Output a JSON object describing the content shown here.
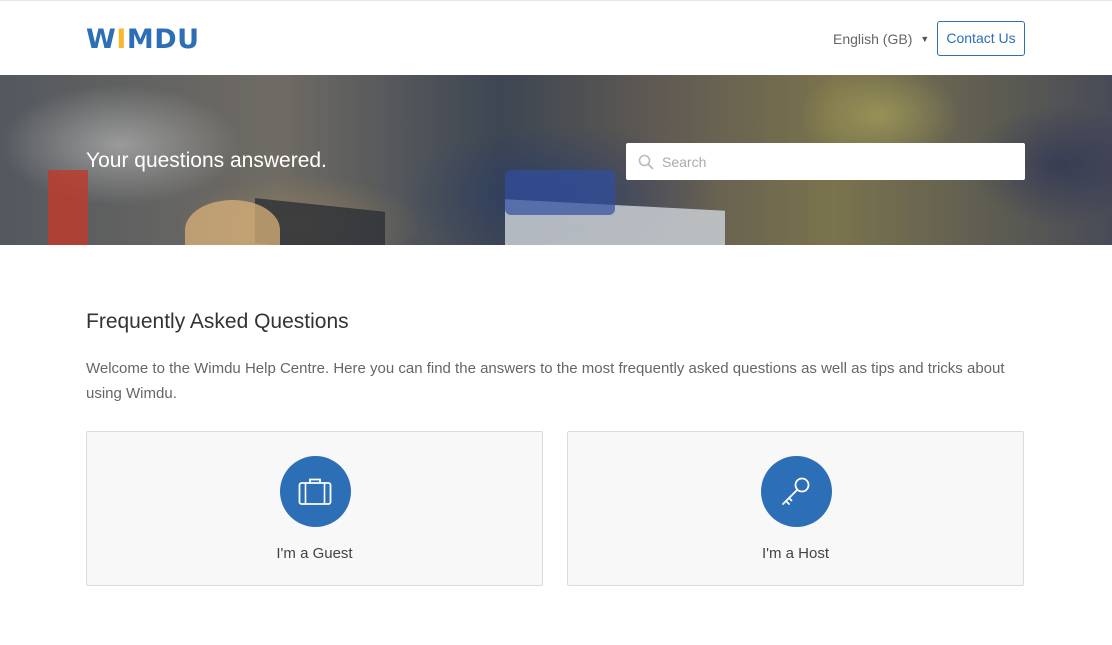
{
  "header": {
    "logo": {
      "pre": "W",
      "accent": "I",
      "post": "MDU"
    },
    "language": "English (GB)",
    "contact_label": "Contact Us"
  },
  "hero": {
    "title": "Your questions answered.",
    "search_placeholder": "Search"
  },
  "faq": {
    "title": "Frequently Asked Questions",
    "description": "Welcome to the Wimdu Help Centre. Here you can find the answers to the most frequently asked questions as well as tips and tricks about using Wimdu."
  },
  "cards": [
    {
      "label": "I'm a Guest",
      "icon": "suitcase-icon"
    },
    {
      "label": "I'm a Host",
      "icon": "key-icon"
    }
  ],
  "colors": {
    "brand_blue": "#2c6fb7",
    "brand_yellow": "#f5b82e"
  }
}
